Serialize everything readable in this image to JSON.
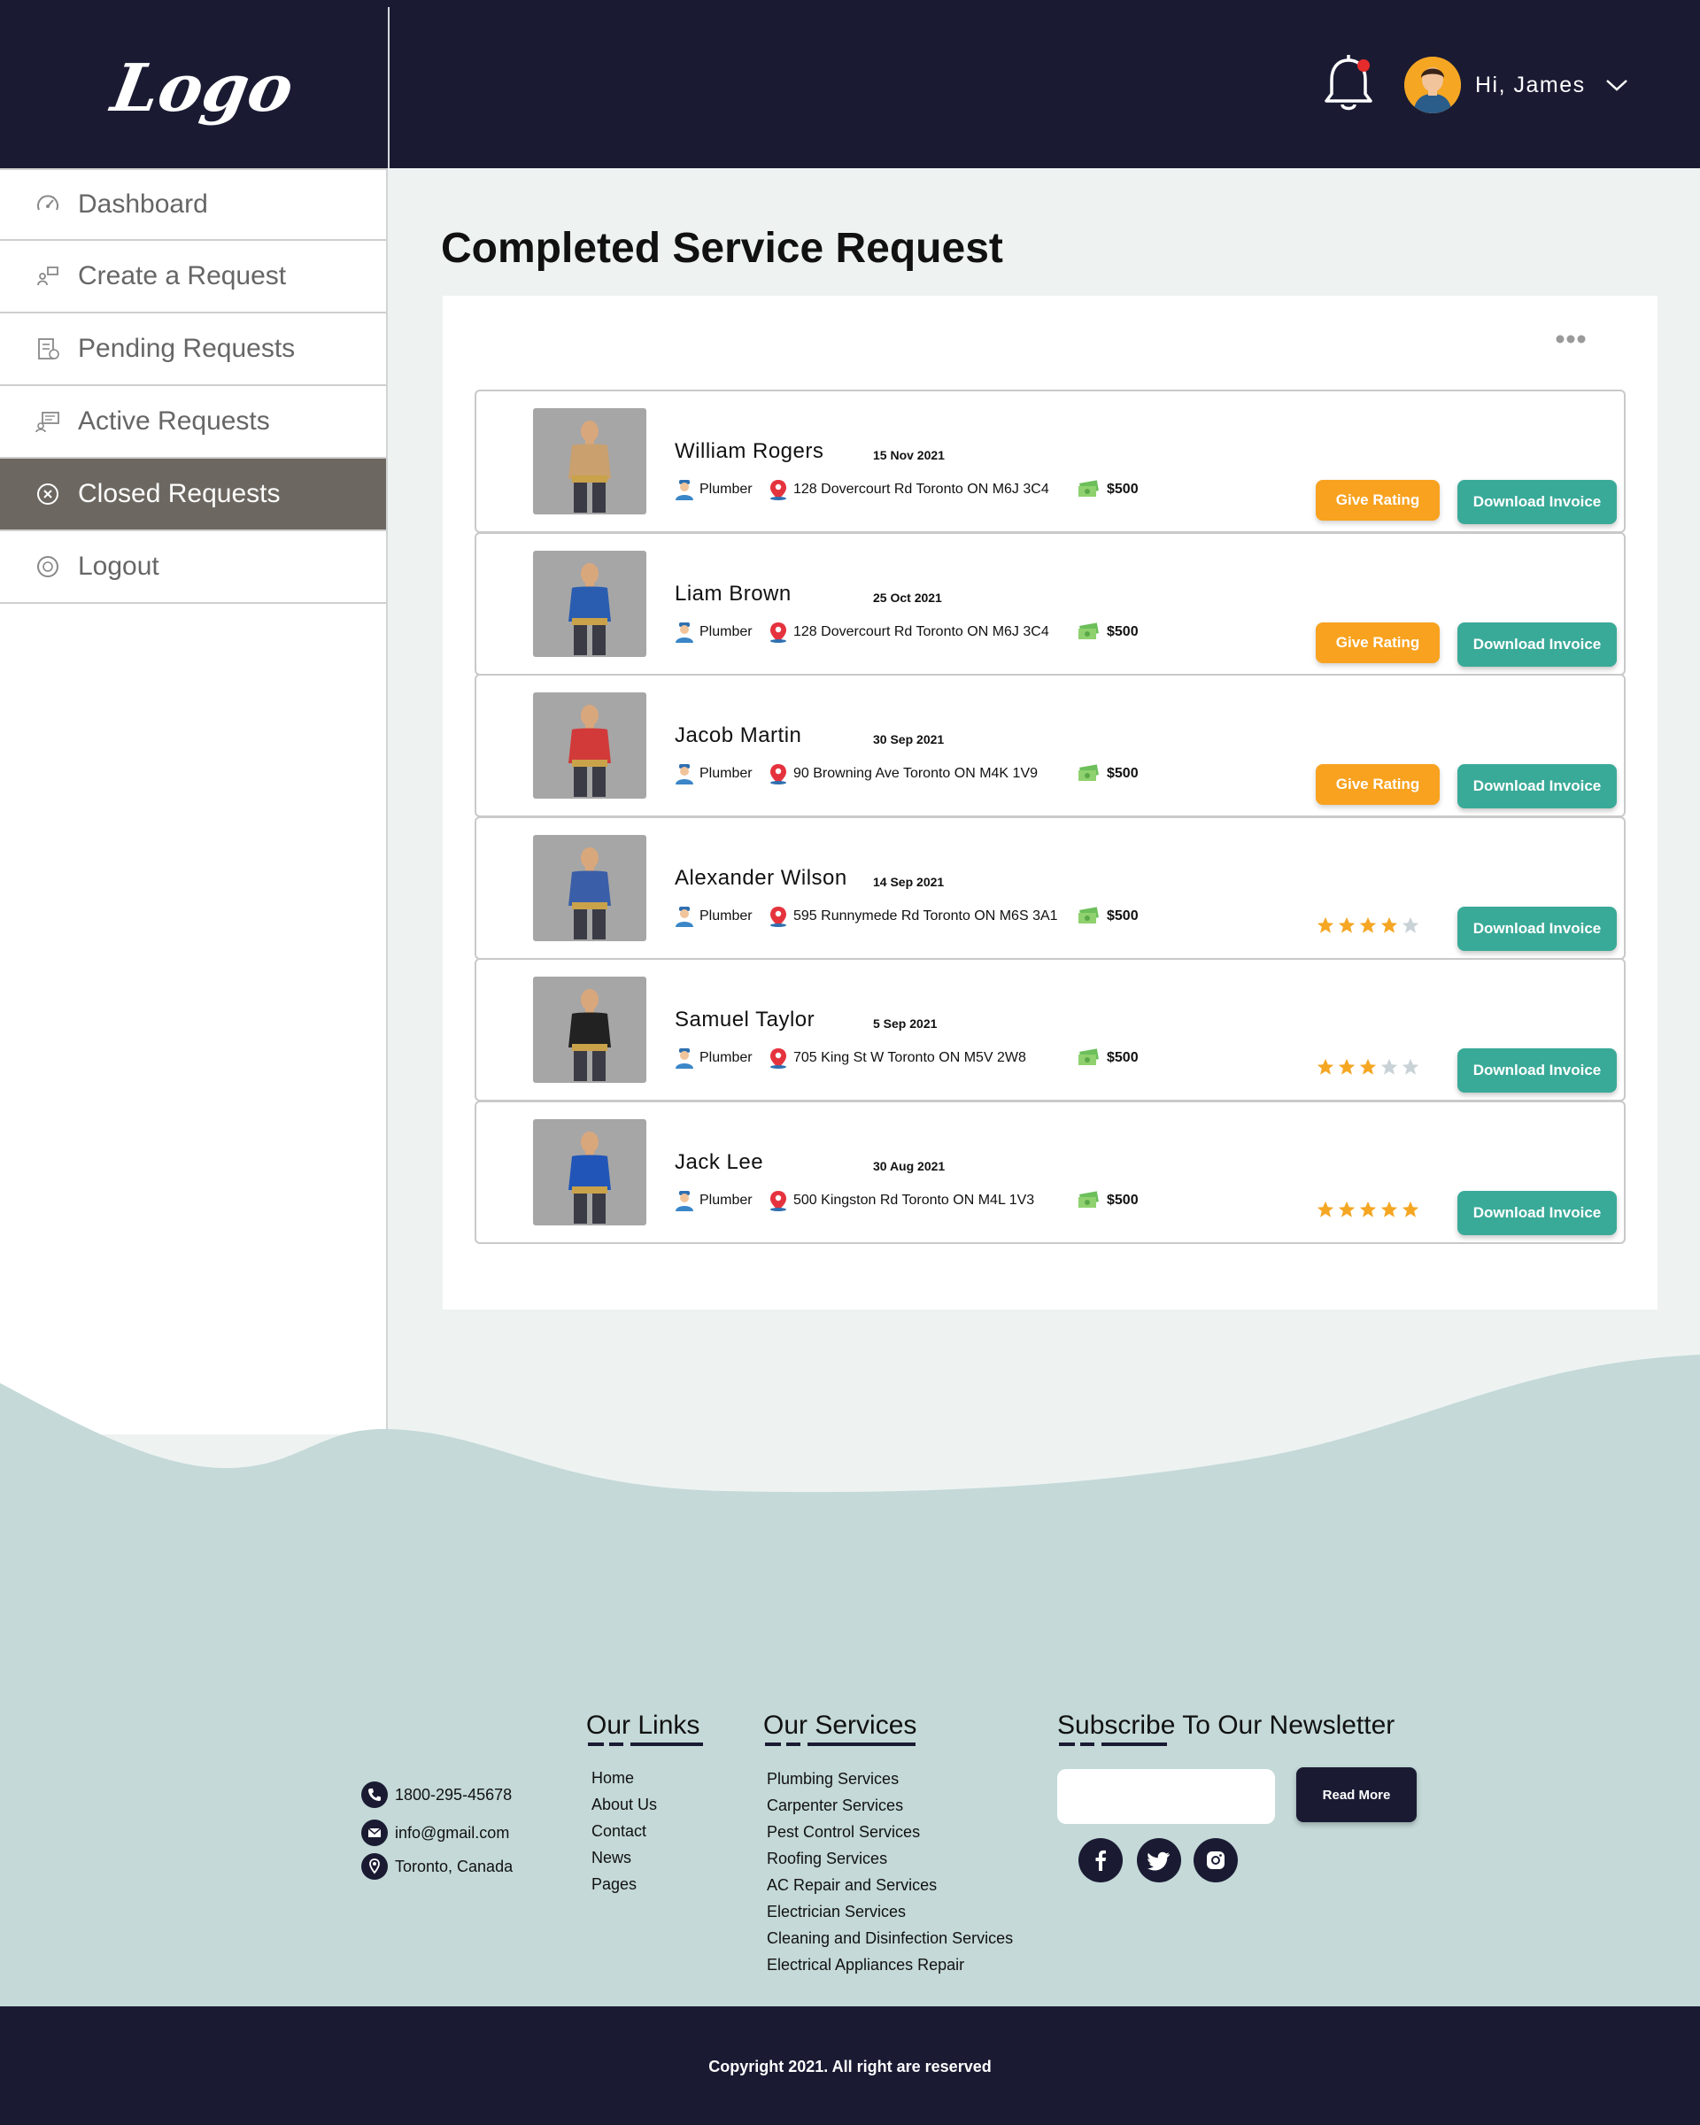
{
  "header": {
    "logo_text": "Logo",
    "greeting": "Hi, James"
  },
  "sidebar": {
    "items": [
      {
        "label": "Dashboard",
        "icon": "speedometer-icon",
        "active": false
      },
      {
        "label": "Create a Request",
        "icon": "create-request-icon",
        "active": false
      },
      {
        "label": "Pending Requests",
        "icon": "pending-document-icon",
        "active": false
      },
      {
        "label": "Active Requests",
        "icon": "active-request-icon",
        "active": false
      },
      {
        "label": "Closed Requests",
        "icon": "close-circle-icon",
        "active": true
      },
      {
        "label": "Logout",
        "icon": "logout-icon",
        "active": false
      }
    ]
  },
  "main": {
    "title": "Completed Service Request",
    "requests": [
      {
        "name": "William Rogers",
        "date": "15 Nov 2021",
        "role": "Plumber",
        "address": "128 Dovercourt Rd Toronto ON M6J 3C4",
        "price": "$500",
        "rate_label": "Give Rating",
        "invoice_label": "Download Invoice",
        "rating": null
      },
      {
        "name": "Liam Brown",
        "date": "25 Oct 2021",
        "role": "Plumber",
        "address": "128 Dovercourt Rd Toronto ON M6J 3C4",
        "price": "$500",
        "rate_label": "Give Rating",
        "invoice_label": "Download Invoice",
        "rating": null
      },
      {
        "name": "Jacob Martin",
        "date": "30 Sep 2021",
        "role": "Plumber",
        "address": "90 Browning Ave Toronto ON M4K 1V9",
        "price": "$500",
        "rate_label": "Give Rating",
        "invoice_label": "Download Invoice",
        "rating": null
      },
      {
        "name": "Alexander Wilson",
        "date": "14 Sep 2021",
        "role": "Plumber",
        "address": "595 Runnymede Rd Toronto ON M6S 3A1",
        "price": "$500",
        "rate_label": "",
        "invoice_label": "Download Invoice",
        "rating": 4
      },
      {
        "name": "Samuel Taylor",
        "date": "5 Sep 2021",
        "role": "Plumber",
        "address": "705 King St W Toronto ON M5V 2W8",
        "price": "$500",
        "rate_label": "",
        "invoice_label": "Download Invoice",
        "rating": 3
      },
      {
        "name": "Jack Lee",
        "date": "30 Aug 2021",
        "role": "Plumber",
        "address": "500 Kingston Rd Toronto ON M4L 1V3",
        "price": "$500",
        "rate_label": "",
        "invoice_label": "Download Invoice",
        "rating": 5
      }
    ]
  },
  "footer": {
    "contact": {
      "phone": "1800-295-45678",
      "email": "info@gmail.com",
      "location": "Toronto, Canada"
    },
    "links_title": "Our Links",
    "links": [
      "Home",
      "About Us",
      "Contact",
      "News",
      "Pages"
    ],
    "services_title": "Our Services",
    "services": [
      "Plumbing Services",
      "Carpenter Services",
      "Pest Control Services",
      "Roofing Services",
      "AC Repair and Services",
      "Electrician Services",
      "Cleaning and Disinfection Services",
      "Electrical Appliances Repair"
    ],
    "newsletter_title": "Subscribe To Our Newsletter",
    "newsletter_button": "Read More",
    "social": [
      "facebook-icon",
      "twitter-icon",
      "instagram-icon"
    ],
    "copyright": "Copyright 2021. All right are reserved"
  },
  "colors": {
    "navy": "#1a1b33",
    "orange": "#f8a21f",
    "teal": "#3aaa98",
    "active_nav": "#6c6861",
    "wave": "#c4d9d8",
    "star": "#f5a623"
  }
}
